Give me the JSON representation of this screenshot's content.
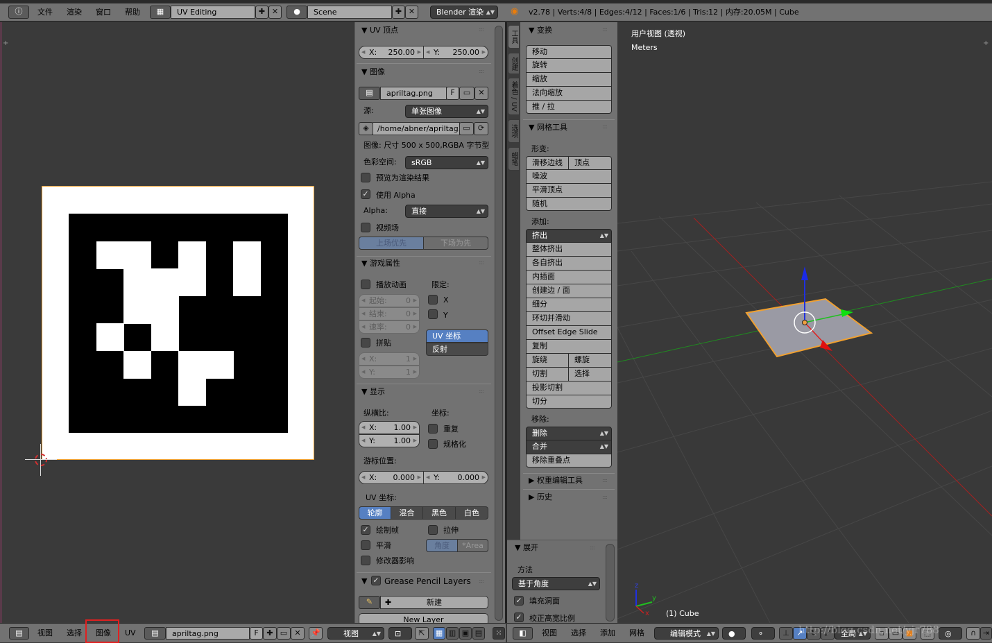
{
  "top_bar": {
    "menus": [
      "文件",
      "渲染",
      "窗口",
      "帮助"
    ],
    "layout": "UV Editing",
    "scene": "Scene",
    "render_engine": "Blender 渲染",
    "status": "v2.78 | Verts:4/8 | Edges:4/12 | Faces:1/6 | Tris:12 | 内存:20.05M | Cube"
  },
  "image_editor": {
    "tag_bits": [
      [
        1,
        1,
        0,
        1,
        0,
        1
      ],
      [
        0,
        1,
        1,
        1,
        0,
        1
      ],
      [
        0,
        1,
        1,
        0,
        0,
        0
      ],
      [
        1,
        0,
        1,
        0,
        0,
        0
      ],
      [
        0,
        1,
        0,
        1,
        1,
        0
      ],
      [
        0,
        0,
        0,
        1,
        0,
        0
      ]
    ],
    "border_color": "#f0a030"
  },
  "properties": {
    "uv_vertex": {
      "title": "UV 顶点",
      "x_label": "X:",
      "x": "250.00",
      "y_label": "Y:",
      "y": "250.00"
    },
    "image": {
      "title": "图像",
      "name": "apriltag.png",
      "fake_user": "F",
      "source_label": "源:",
      "source": "单张图像",
      "filepath": "/home/abner/apriltag....",
      "info": "图像: 尺寸 500 x 500,RGBA 字节型",
      "colorspace_label": "色彩空间:",
      "colorspace": "sRGB",
      "view_as_render": {
        "label": "预览为渲染结果",
        "checked": false
      },
      "use_alpha": {
        "label": "使用 Alpha",
        "checked": true
      },
      "alpha_label": "Alpha:",
      "alpha": "直接",
      "fields": {
        "label": "视频场",
        "checked": false
      },
      "upper_first": "上场优先",
      "lower_first": "下场为先"
    },
    "game": {
      "title": "游戏属性",
      "animation": {
        "label": "播放动画",
        "checked": false
      },
      "clamp_label": "限定:",
      "start_label": "起始:",
      "start": "0",
      "end_label": "结束:",
      "end": "0",
      "speed_label": "速率:",
      "speed": "0",
      "clamp_x": {
        "label": "X",
        "checked": false
      },
      "clamp_y": {
        "label": "Y",
        "checked": false
      },
      "mapping_uv": "UV 坐标",
      "mapping_reflection": "反射",
      "tiles": {
        "label": "拼贴",
        "checked": false
      },
      "tile_x_label": "X:",
      "tile_x": "1",
      "tile_y_label": "Y:",
      "tile_y": "1"
    },
    "display": {
      "title": "显示",
      "aspect_label": "纵横比:",
      "coords_label": "坐标:",
      "aspect_x_label": "X:",
      "aspect_x": "1.00",
      "aspect_y_label": "Y:",
      "aspect_y": "1.00",
      "repeat": {
        "label": "重复",
        "checked": false
      },
      "normalized": {
        "label": "规格化",
        "checked": false
      },
      "cursor_label": "游标位置:",
      "cursor_x_label": "X:",
      "cursor_x": "0.000",
      "cursor_y_label": "Y:",
      "cursor_y": "0.000",
      "uv_label": "UV 坐标:",
      "uv_modes": [
        "轮廓",
        "混合",
        "黑色",
        "白色"
      ],
      "draw_faces": {
        "label": "绘制帧",
        "checked": true
      },
      "stretch": {
        "label": "拉伸",
        "checked": false
      },
      "smooth": {
        "label": "平滑",
        "checked": false
      },
      "stretch_angle": "角度",
      "stretch_area": "*Area",
      "modified": {
        "label": "修改器影响",
        "checked": false
      }
    },
    "grease_pencil": {
      "title": "Grease Pencil Layers",
      "checked": true,
      "new": "新建",
      "new_layer": "New Layer"
    }
  },
  "tool_shelf": {
    "tabs": [
      "工具",
      "创建",
      "着色 / UV",
      "选项",
      "蜡笔"
    ],
    "transform": {
      "title": "变换",
      "items": [
        "移动",
        "旋转",
        "缩放",
        "法向缩放",
        "推 / 拉"
      ]
    },
    "mesh_tools": {
      "title": "网格工具",
      "deform_label": "形变:",
      "deform": [
        "滑移边线",
        "顶点",
        "噪波",
        "平滑顶点",
        "随机"
      ],
      "add_label": "添加:",
      "add": [
        "挤出",
        "整体挤出",
        "各自挤出",
        "内插面",
        "创建边 / 面",
        "细分",
        "环切并滑动",
        "Offset Edge Slide",
        "复制",
        "旋绕",
        "螺旋",
        "切割",
        "选择",
        "投影切割",
        "切分"
      ],
      "remove_label": "移除:",
      "remove": [
        "删除",
        "合并",
        "移除重叠点"
      ]
    },
    "weight_tools": "权重编辑工具",
    "history": "历史",
    "operator": {
      "title": "展开",
      "method_label": "方法",
      "method": "基于角度",
      "fill_holes": {
        "label": "填充洞面",
        "checked": true
      },
      "correct_aspect": {
        "label": "校正高宽比例",
        "checked": true
      }
    }
  },
  "viewport": {
    "view_name": "用户视图 (透视)",
    "units": "Meters",
    "object": "(1) Cube",
    "axis_x": "x",
    "axis_y": "y",
    "axis_z": "z"
  },
  "uv_header": {
    "menus": [
      "视图",
      "选择",
      "图像",
      "UV"
    ],
    "image": "apriltag.png",
    "fake_user": "F",
    "view_mode": "视图",
    "highlight_color": "#e02020"
  },
  "view3d_header": {
    "menus": [
      "视图",
      "选择",
      "添加",
      "网格"
    ],
    "mode": "编辑模式",
    "pivot": "全局",
    "watermark": "http://blog.csdn.net/yjr788"
  }
}
